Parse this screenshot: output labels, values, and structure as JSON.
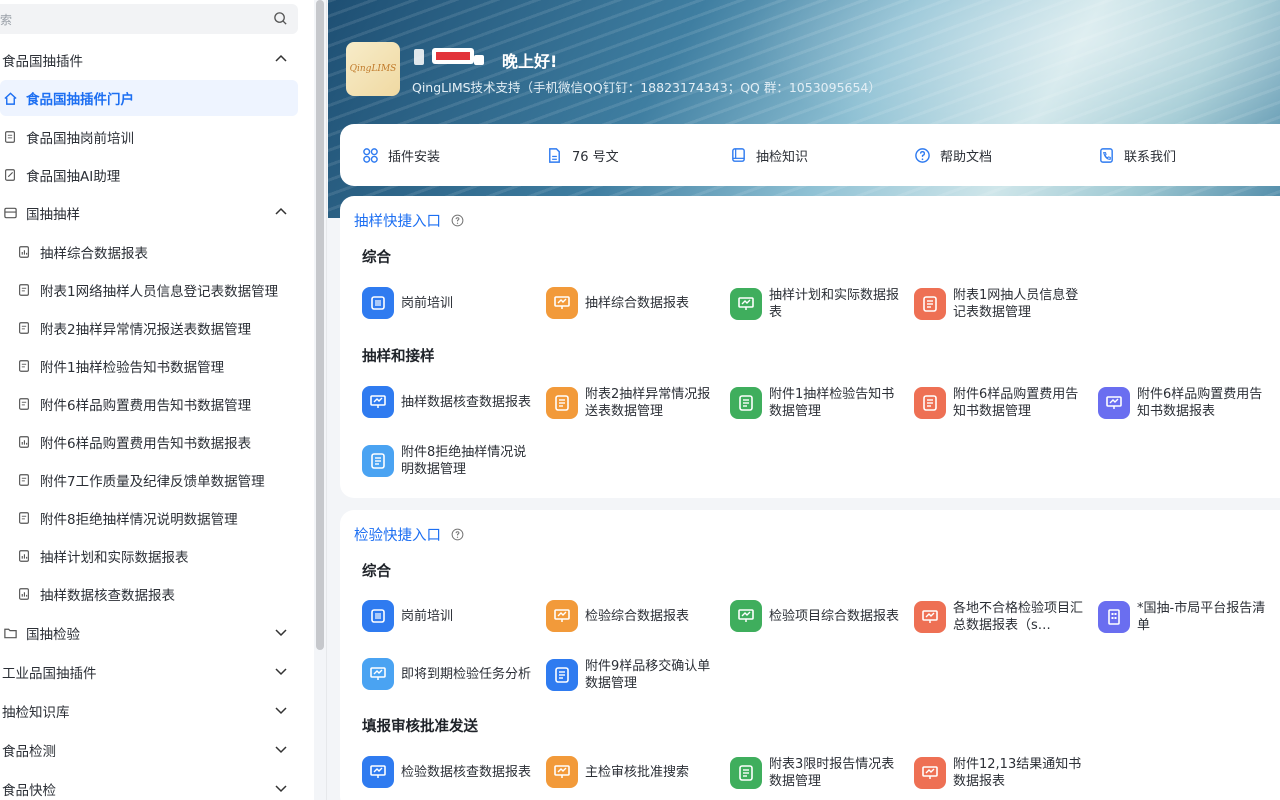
{
  "sidebar": {
    "search_placeholder": "索",
    "items": [
      {
        "label": "食品国抽插件"
      },
      {
        "label": "食品国抽插件门户"
      },
      {
        "label": "食品国抽岗前培训"
      },
      {
        "label": "食品国抽AI助理"
      },
      {
        "label": "国抽抽样"
      },
      {
        "label": "抽样综合数据报表"
      },
      {
        "label": "附表1网络抽样人员信息登记表数据管理"
      },
      {
        "label": "附表2抽样异常情况报送表数据管理"
      },
      {
        "label": "附件1抽样检验告知书数据管理"
      },
      {
        "label": "附件6样品购置费用告知书数据管理"
      },
      {
        "label": "附件6样品购置费用告知书数据报表"
      },
      {
        "label": "附件7工作质量及纪律反馈单数据管理"
      },
      {
        "label": "附件8拒绝抽样情况说明数据管理"
      },
      {
        "label": "抽样计划和实际数据报表"
      },
      {
        "label": "抽样数据核查数据报表"
      },
      {
        "label": "国抽检验"
      },
      {
        "label": "工业品国抽插件"
      },
      {
        "label": "抽检知识库"
      },
      {
        "label": "食品检测"
      },
      {
        "label": "食品快检"
      }
    ]
  },
  "banner": {
    "logo_text": "QingLIMS",
    "greeting": "晚上好!",
    "support": "QingLIMS技术支持（手机微信QQ钉钉：18823174343；QQ 群：1053095654）"
  },
  "quickbar": [
    {
      "label": "插件安装",
      "icon": "apps-icon"
    },
    {
      "label": "76 号文",
      "icon": "document-icon"
    },
    {
      "label": "抽检知识",
      "icon": "book-icon"
    },
    {
      "label": "帮助文档",
      "icon": "help-icon"
    },
    {
      "label": "联系我们",
      "icon": "contact-icon"
    }
  ],
  "sampling": {
    "title": "抽样快捷入口",
    "groups": [
      {
        "title": "综合",
        "tiles": [
          "岗前培训",
          "抽样综合数据报表",
          "抽样计划和实际数据报表",
          "附表1网抽人员信息登记表数据管理"
        ]
      },
      {
        "title": "抽样和接样",
        "tiles": [
          "抽样数据核查数据报表",
          "附表2抽样异常情况报送表数据管理",
          "附件1抽样检验告知书数据管理",
          "附件6样品购置费用告知书数据管理",
          "附件6样品购置费用告知书数据报表",
          "附件8拒绝抽样情况说明数据管理"
        ]
      }
    ]
  },
  "inspection": {
    "title": "检验快捷入口",
    "groups": [
      {
        "title": "综合",
        "tiles": [
          "岗前培训",
          "检验综合数据报表",
          "检验项目综合数据报表",
          "各地不合格检验项目汇总数据报表（s…",
          "*国抽-市局平台报告清单",
          "即将到期检验任务分析",
          "附件9样品移交确认单数据管理"
        ]
      },
      {
        "title": "填报审核批准发送",
        "tiles": [
          "检验数据核查数据报表",
          "主检审核批准搜索",
          "附表3限时报告情况表数据管理",
          "附件12,13结果通知书数据报表"
        ]
      }
    ]
  },
  "colors": {
    "accent": "#1d6ff2",
    "blue": "#2f7bf0",
    "orange": "#f29a3a",
    "green": "#3fae5d",
    "red": "#ee7054",
    "purple": "#6a6ef0"
  }
}
